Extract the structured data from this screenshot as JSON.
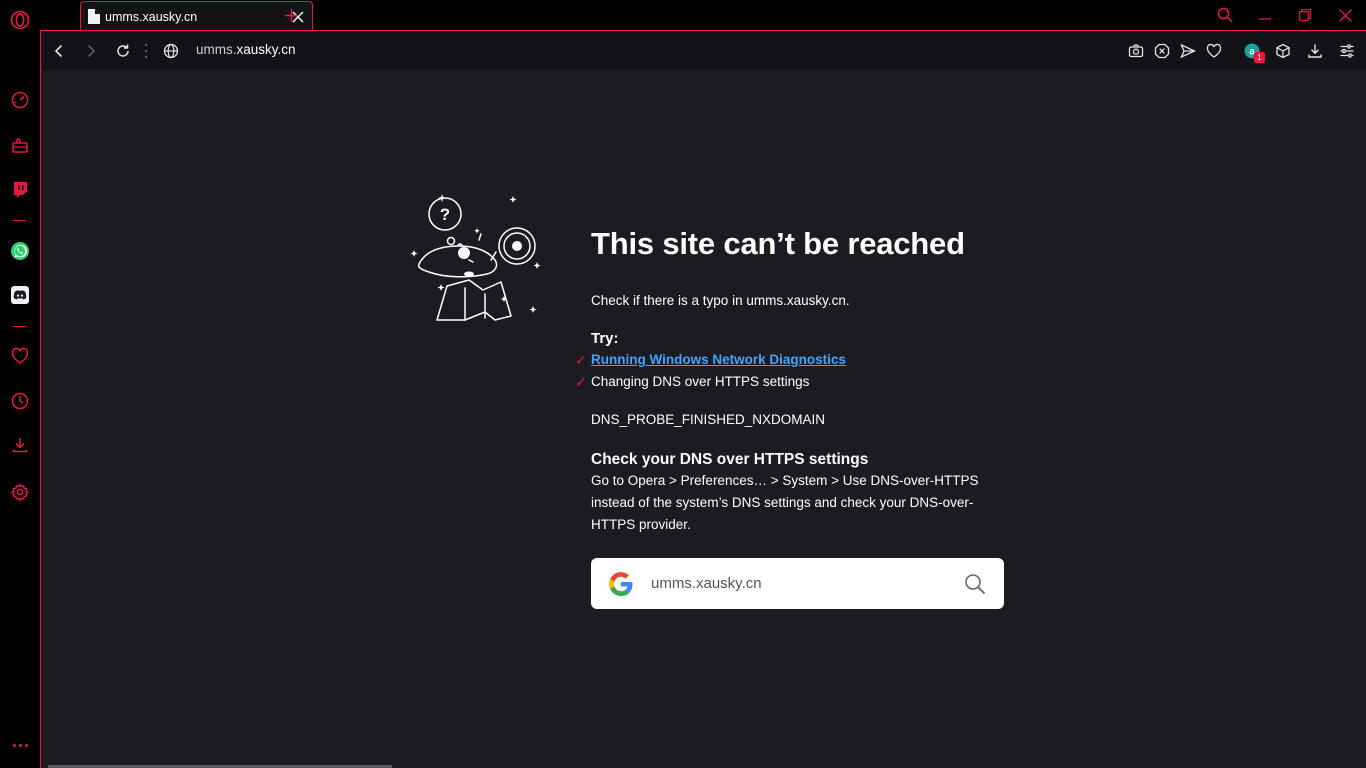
{
  "sidebar": {
    "items": [
      {
        "name": "opera-logo-icon"
      },
      {
        "name": "speed-dial-icon"
      },
      {
        "name": "extensions-icon"
      },
      {
        "name": "twitch-icon"
      },
      {
        "name": "whatsapp-icon"
      },
      {
        "name": "discord-icon"
      },
      {
        "name": "bookmarks-heart-icon"
      },
      {
        "name": "history-icon"
      },
      {
        "name": "downloads-icon"
      },
      {
        "name": "settings-icon"
      }
    ],
    "accent": "#e8173f"
  },
  "tab": {
    "title": "umms.xausky.cn"
  },
  "address_bar": {
    "url_prefix": "umms.",
    "url_domain": "xausky.cn",
    "extension_badge": "1"
  },
  "error": {
    "title": "This site can’t be reached",
    "typo_hint": "Check if there is a typo in umms.xausky.cn.",
    "try_label": "Try:",
    "suggestions": [
      {
        "text": "Running Windows Network Diagnostics",
        "is_link": true
      },
      {
        "text": "Changing DNS over HTTPS settings",
        "is_link": false
      }
    ],
    "error_code": "DNS_PROBE_FINISHED_NXDOMAIN",
    "dns_heading": "Check your DNS over HTTPS settings",
    "dns_body": "Go to Opera > Preferences… > System > Use DNS-over-HTTPS instead of the system’s DNS settings and check your DNS-over-HTTPS provider."
  },
  "search": {
    "value": "umms.xausky.cn"
  },
  "colors": {
    "accent": "#e8173f",
    "content_bg": "#1d1b22",
    "link": "#3ea6ff"
  }
}
